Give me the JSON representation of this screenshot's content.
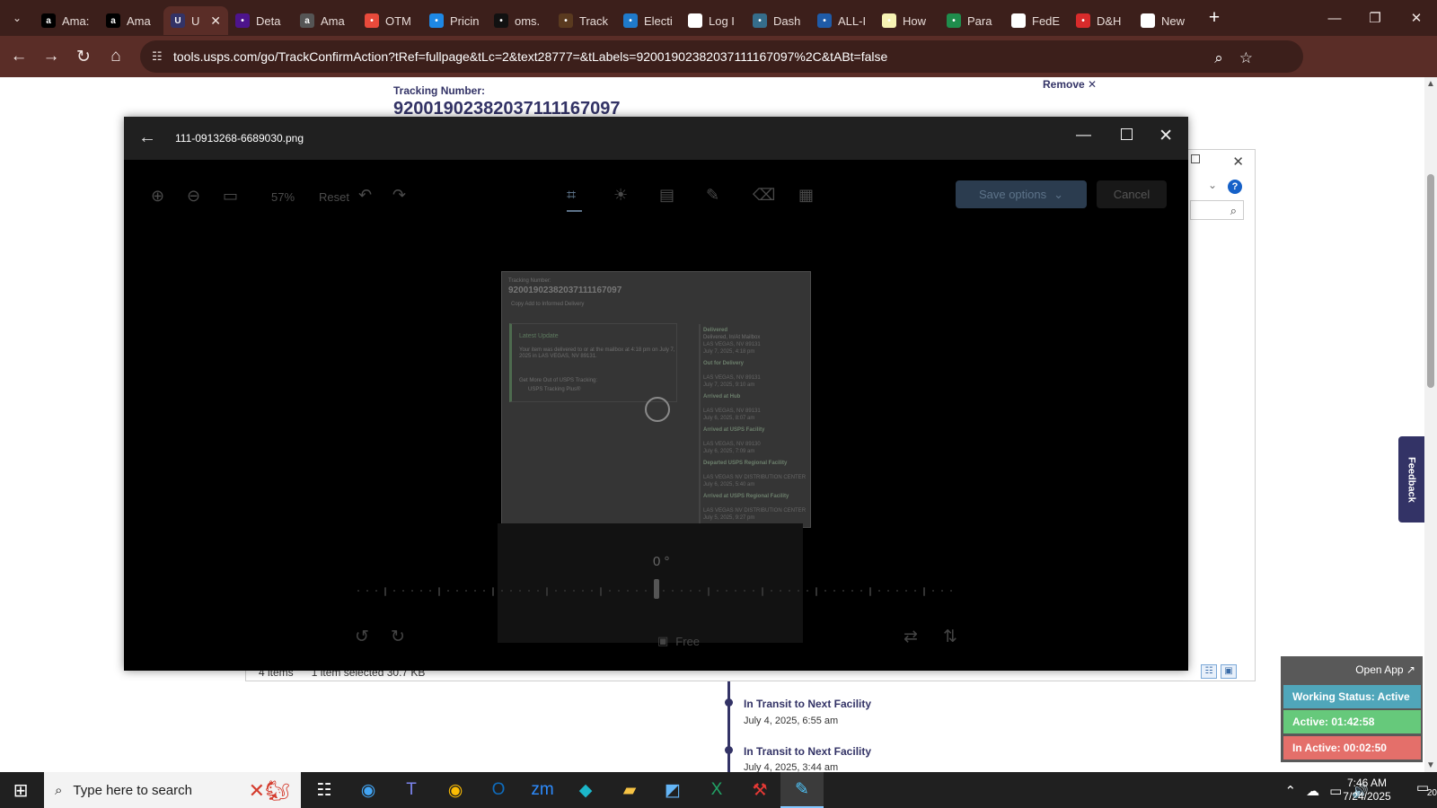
{
  "browser": {
    "tabs": [
      {
        "label": "Ama:",
        "icon": "amazon-icon",
        "color": "#000000"
      },
      {
        "label": "Ama",
        "icon": "amazon-icon",
        "color": "#000000"
      },
      {
        "label": "U",
        "icon": "usps-icon",
        "color": "#333366",
        "active": true
      },
      {
        "label": "Deta",
        "icon": "fedex-icon",
        "color": "#4d148c"
      },
      {
        "label": "Ama",
        "icon": "amazon-icon",
        "color": "#555555"
      },
      {
        "label": "OTM",
        "icon": "otm-icon",
        "color": "#e84a3b"
      },
      {
        "label": "Pricin",
        "icon": "pricing-icon",
        "color": "#1e88e5"
      },
      {
        "label": "oms.",
        "icon": "oms-icon",
        "color": "#111111"
      },
      {
        "label": "Track",
        "icon": "ups-icon",
        "color": "#5a3a1f"
      },
      {
        "label": "Electi",
        "icon": "ec-icon",
        "color": "#1f7acb"
      },
      {
        "label": "Log I",
        "icon": "login-icon",
        "color": "#ffffff"
      },
      {
        "label": "Dash",
        "icon": "dash-icon",
        "color": "#356d8b"
      },
      {
        "label": "ALL-I",
        "icon": "seventeen-icon",
        "color": "#1f5ba8"
      },
      {
        "label": "How",
        "icon": "how-icon",
        "color": "#f7f2b3"
      },
      {
        "label": "Para",
        "icon": "sheets-icon",
        "color": "#1f8d4c"
      },
      {
        "label": "FedE",
        "icon": "fedex-globe-icon",
        "color": "#ffffff"
      },
      {
        "label": "D&H",
        "icon": "dh-icon",
        "color": "#d82b2b"
      },
      {
        "label": "New",
        "icon": "new-tab-icon",
        "color": "#ffffff"
      }
    ],
    "address": "tools.usps.com/go/TrackConfirmAction?tRef=fullpage&tLc=2&text28777=&tLabels=92001902382037111167097%2C&tABt=false"
  },
  "page": {
    "tracking_label": "Tracking Number:",
    "tracking_number": "92001902382037111167097",
    "remove_label": "Remove",
    "events": [
      {
        "title": "In Transit to Next Facility",
        "date": "July 4, 2025, 6:55 am"
      },
      {
        "title": "In Transit to Next Facility",
        "date": "July 4, 2025, 3:44 am"
      }
    ],
    "feedback_label": "Feedback"
  },
  "explorer": {
    "items": "4 items",
    "selected": "1 item selected 30.7 KB"
  },
  "viewer": {
    "filename": "111-0913268-6689030.png",
    "zoom": "57%",
    "reset": "Reset",
    "save": "Save options",
    "cancel": "Cancel",
    "degree": "0 °",
    "free": "Free",
    "preview": {
      "label": "Tracking Number:",
      "number": "92001902382037111167097",
      "small_links": "Copy   Add to Informed Delivery",
      "latest_update": "Latest Update",
      "latest_desc_1": "Your item was delivered to or at the mailbox at 4:18 pm on July 7,",
      "latest_desc_2": "2025 in LAS VEGAS, NV 89131.",
      "get_more": "Get More Out of USPS Tracking:",
      "tracking_plus": "USPS Tracking Plus®",
      "timeline": [
        {
          "title": "Delivered",
          "sub": "Delivered, In/At Mailbox",
          "loc": "LAS VEGAS, NV 89131",
          "date": "July 7, 2025, 4:18 pm"
        },
        {
          "title": "Out for Delivery",
          "sub": "",
          "loc": "LAS VEGAS, NV 89131",
          "date": "July 7, 2025, 9:10 am"
        },
        {
          "title": "Arrived at Hub",
          "sub": "",
          "loc": "LAS VEGAS, NV 89131",
          "date": "July 6, 2025, 8:07 am"
        },
        {
          "title": "Arrived at USPS Facility",
          "sub": "",
          "loc": "LAS VEGAS, NV 89130",
          "date": "July 6, 2025, 7:09 am"
        },
        {
          "title": "Departed USPS Regional Facility",
          "sub": "",
          "loc": "LAS VEGAS NV DISTRIBUTION CENTER",
          "date": "July 6, 2025, 5:40 am"
        },
        {
          "title": "Arrived at USPS Regional Facility",
          "sub": "",
          "loc": "LAS VEGAS NV DISTRIBUTION CENTER",
          "date": "July 5, 2025, 9:27 pm"
        }
      ]
    }
  },
  "status_widget": {
    "open_app": "Open App ↗",
    "working": "Working Status: Active",
    "active": "Active: 01:42:58",
    "inactive": "In Active: 00:02:50",
    "colors": {
      "working": "#50a6ba",
      "active": "#66c97b",
      "inactive": "#e46f6a"
    }
  },
  "taskbar": {
    "search_placeholder": "Type here to search",
    "time": "7:46 AM",
    "date": "7/24/2025",
    "notification_count": "20"
  }
}
